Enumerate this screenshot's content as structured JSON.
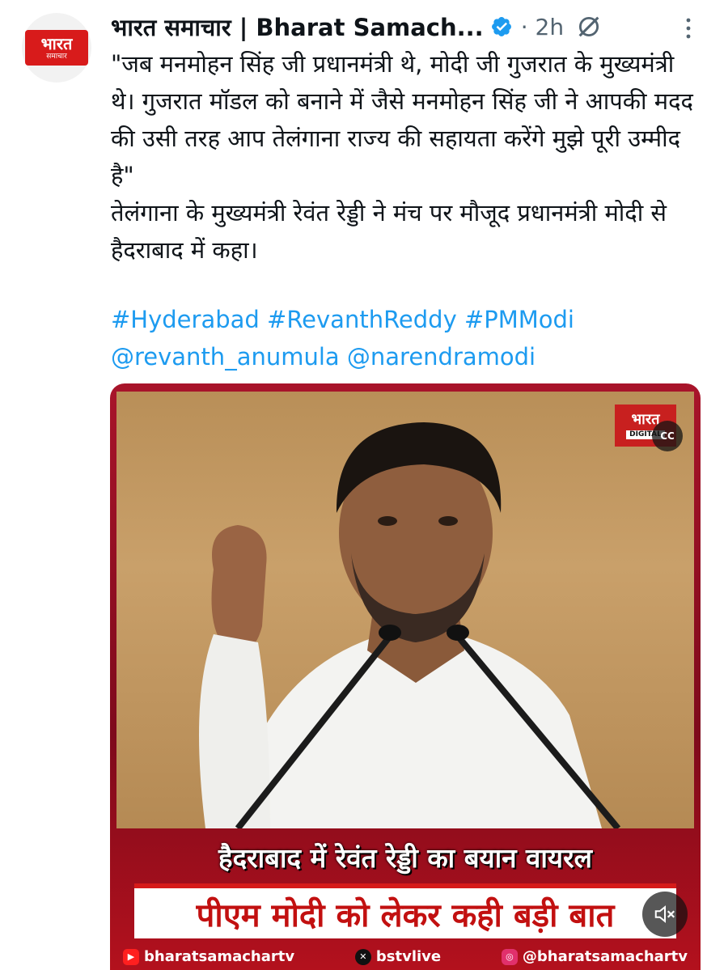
{
  "account": {
    "avatar_text_big": "भारत",
    "avatar_text_small": "समाचार",
    "display_name": "भारत समाचार | Bharat Samach...",
    "time": "2h"
  },
  "tweet": {
    "lines": [
      "\"जब मनमोहन सिंह जी प्रधानमंत्री थे, मोदी जी गुजरात के मुख्यमंत्री थे। गुजरात मॉडल को बनाने में जैसे मनमोहन सिंह जी ने आपकी मदद की उसी तरह आप तेलंगाना राज्य की सहायता करेंगे मुझे पूरी उम्मीद है\"",
      "तेलंगाना के मुख्यमंत्री रेवंत रेड्डी ने मंच पर मौजूद प्रधानमंत्री मोदी से हैदराबाद में कहा।"
    ],
    "hashtags": "#Hyderabad #RevanthReddy #PMModi",
    "mentions": "@revanth_anumula @narendramodi"
  },
  "media": {
    "watermark_big": "भारत",
    "watermark_small": "DIGITAL",
    "cc_label": "CC",
    "caption_top": "हैदराबाद में रेवंत रेड्डी का बयान वायरल",
    "caption_bottom": "पीएम मोदी को लेकर कही बड़ी बात",
    "socials": {
      "youtube": "bharatsamachartv",
      "x": "bstvlive",
      "instagram": "@bharatsamachartv"
    }
  },
  "icons": {
    "verified": "verified-badge-icon",
    "grok": "grok-icon",
    "more": "more-options-icon",
    "mute": "mute-icon"
  },
  "colors": {
    "link": "#1d9bf0",
    "verified": "#1d9bf0",
    "brand_red": "#d81b1b"
  }
}
